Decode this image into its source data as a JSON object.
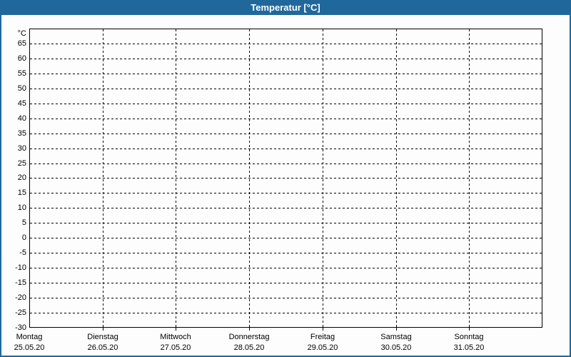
{
  "window": {
    "title": "Temperatur [°C]"
  },
  "colors": {
    "title_bar_bg": "#20689b",
    "title_text": "#ffffff",
    "frame_border": "#20689b",
    "background": "#fdfdfd",
    "axis": "#000000",
    "grid": "#000000",
    "label_text": "#000000"
  },
  "chart_data": {
    "type": "line",
    "title": "Temperatur [°C]",
    "y_unit_label": "°C",
    "ylabel": "",
    "xlabel": "",
    "ylim": [
      -30,
      70
    ],
    "y_ticks": [
      65,
      60,
      55,
      50,
      45,
      40,
      35,
      30,
      25,
      20,
      15,
      10,
      5,
      0,
      -5,
      -10,
      -15,
      -20,
      -25,
      -30
    ],
    "x_days": [
      {
        "name": "Montag",
        "date": "25.05.20"
      },
      {
        "name": "Dienstag",
        "date": "26.05.20"
      },
      {
        "name": "Mittwoch",
        "date": "27.05.20"
      },
      {
        "name": "Donnerstag",
        "date": "28.05.20"
      },
      {
        "name": "Freitag",
        "date": "29.05.20"
      },
      {
        "name": "Samstag",
        "date": "30.05.20"
      },
      {
        "name": "Sonntag",
        "date": "31.05.20"
      }
    ],
    "series": [],
    "grid": "dashed",
    "legend": "none"
  }
}
